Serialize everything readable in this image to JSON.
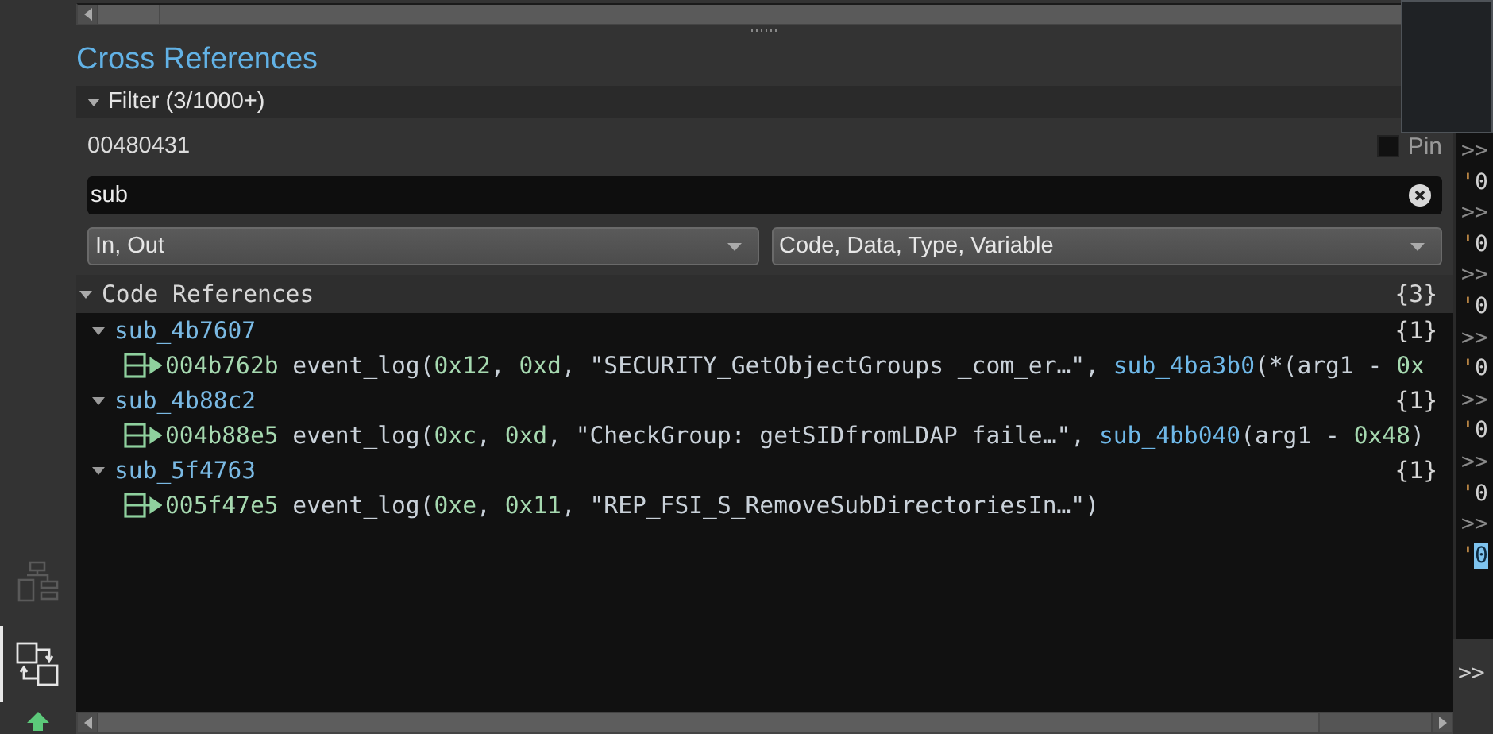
{
  "sidebar": [
    {
      "kind": "hierarchy",
      "selected": false
    },
    {
      "kind": "xrefs",
      "selected": true
    },
    {
      "kind": "arrow",
      "selected": false
    }
  ],
  "title": "Cross References",
  "filter": {
    "label": "Filter (3/1000+)",
    "expanded": true
  },
  "address": "00480431",
  "pin": {
    "label": "Pin",
    "checked": false
  },
  "search": {
    "value": "sub"
  },
  "dropdowns": [
    "In, Out",
    "Code, Data, Type, Variable"
  ],
  "section": {
    "label": "Code References",
    "count": "{3}",
    "expanded": true,
    "groups": [
      {
        "name": "sub_4b7607",
        "count": "{1}",
        "expanded": true,
        "refs": [
          {
            "address": "004b762b",
            "tokens": [
              {
                "t": "event_log(",
                "kind": "plain"
              },
              {
                "t": "0x12",
                "kind": "num"
              },
              {
                "t": ", ",
                "kind": "plain"
              },
              {
                "t": "0xd",
                "kind": "num"
              },
              {
                "t": ", \"SECURITY_GetObjectGroups _com_er…\", ",
                "kind": "plain"
              },
              {
                "t": "sub_4ba3b0",
                "kind": "func"
              },
              {
                "t": "(*(arg1 - ",
                "kind": "plain"
              },
              {
                "t": "0x",
                "kind": "num"
              }
            ]
          }
        ]
      },
      {
        "name": "sub_4b88c2",
        "count": "{1}",
        "expanded": true,
        "refs": [
          {
            "address": "004b88e5",
            "tokens": [
              {
                "t": "event_log(",
                "kind": "plain"
              },
              {
                "t": "0xc",
                "kind": "num"
              },
              {
                "t": ", ",
                "kind": "plain"
              },
              {
                "t": "0xd",
                "kind": "num"
              },
              {
                "t": ", \"CheckGroup: getSIDfromLDAP faile…\", ",
                "kind": "plain"
              },
              {
                "t": "sub_4bb040",
                "kind": "func"
              },
              {
                "t": "(arg1 - ",
                "kind": "plain"
              },
              {
                "t": "0x48",
                "kind": "num"
              },
              {
                "t": ")",
                "kind": "plain"
              }
            ]
          }
        ]
      },
      {
        "name": "sub_5f4763",
        "count": "{1}",
        "expanded": true,
        "refs": [
          {
            "address": "005f47e5",
            "tokens": [
              {
                "t": "event_log(",
                "kind": "plain"
              },
              {
                "t": "0xe",
                "kind": "num"
              },
              {
                "t": ", ",
                "kind": "plain"
              },
              {
                "t": "0x11",
                "kind": "num"
              },
              {
                "t": ", \"REP_FSI_S_RemoveSubDirectoriesIn…\")",
                "kind": "plain"
              }
            ]
          }
        ]
      }
    ]
  },
  "console": {
    "lines": [
      {
        "kind": "prompt",
        "text": ">>"
      },
      {
        "kind": "output",
        "prefix": "'",
        "text": "0",
        "highlighted": false
      },
      {
        "kind": "prompt",
        "text": ">>"
      },
      {
        "kind": "output",
        "prefix": "'",
        "text": "0",
        "highlighted": false
      },
      {
        "kind": "prompt",
        "text": ">>"
      },
      {
        "kind": "output",
        "prefix": "'",
        "text": "0",
        "highlighted": false
      },
      {
        "kind": "prompt",
        "text": ">>"
      },
      {
        "kind": "output",
        "prefix": "'",
        "text": "0",
        "highlighted": false
      },
      {
        "kind": "prompt",
        "text": ">>"
      },
      {
        "kind": "output",
        "prefix": "'",
        "text": "0",
        "highlighted": false
      },
      {
        "kind": "prompt",
        "text": ">>"
      },
      {
        "kind": "output",
        "prefix": "'",
        "text": "0",
        "highlighted": false
      },
      {
        "kind": "prompt",
        "text": ">>"
      },
      {
        "kind": "output",
        "prefix": "'",
        "text": "0",
        "highlighted": true
      }
    ],
    "input_prompt": ">>"
  }
}
